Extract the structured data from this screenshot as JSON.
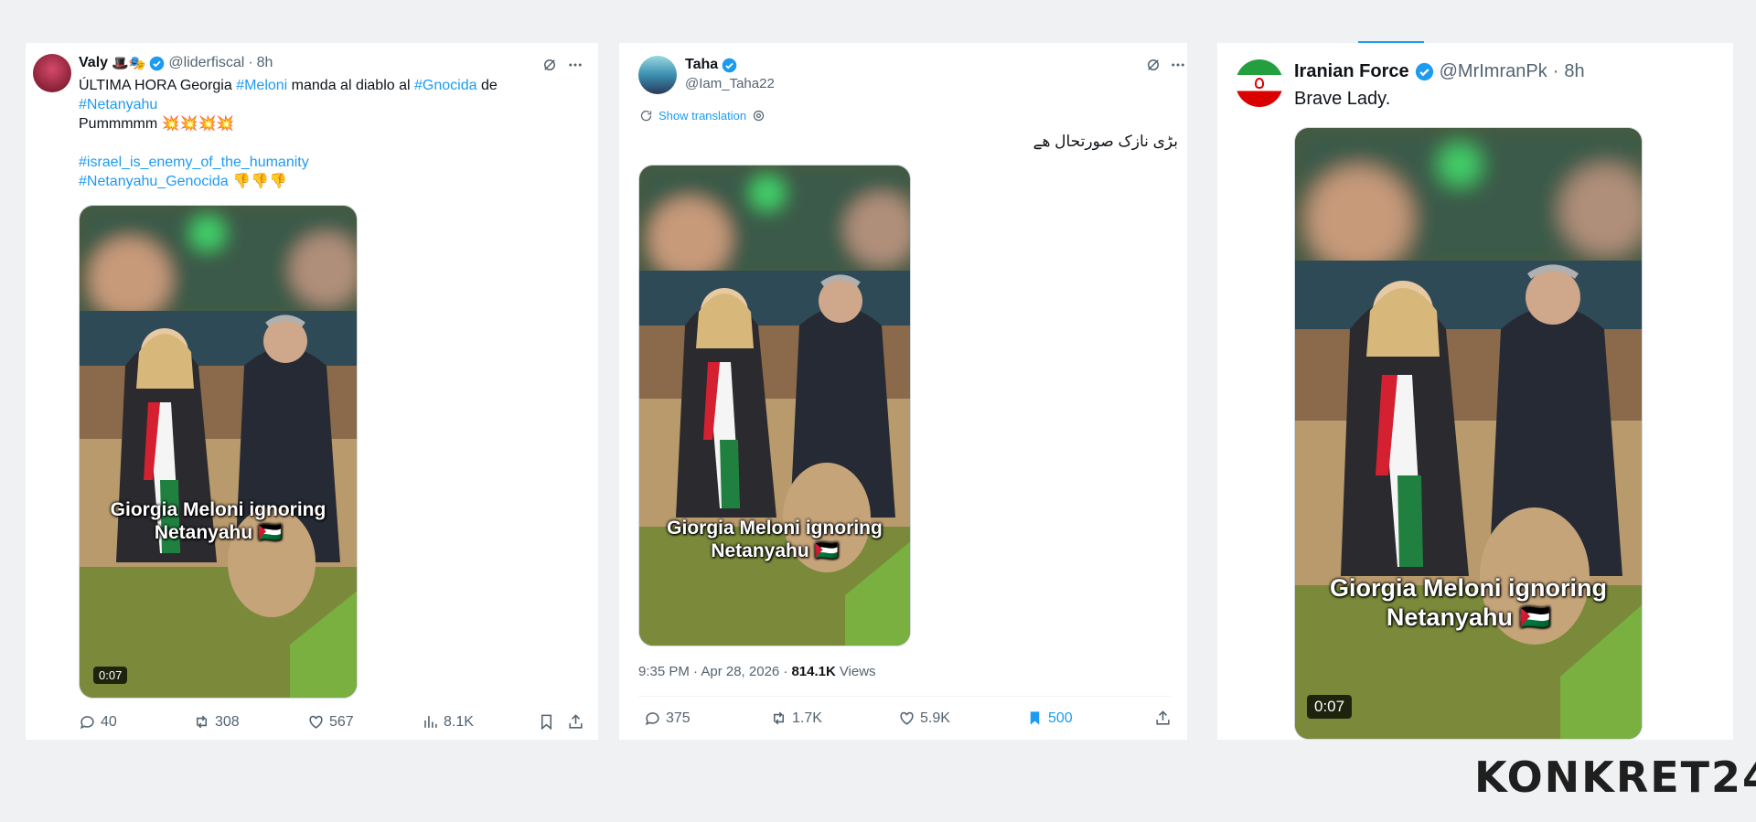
{
  "tweet1": {
    "display_name": "Valy",
    "emojis": "🎩🎭",
    "handle": "@liderfiscal",
    "time": "8h",
    "text_lines": [
      [
        {
          "t": "ÚLTIMA HORA Georgia ",
          "c": "text"
        },
        {
          "t": "#Meloni",
          "c": "link"
        },
        {
          "t": " manda al diablo al ",
          "c": "text"
        },
        {
          "t": "#Gnocida",
          "c": "link"
        },
        {
          "t": " de",
          "c": "text"
        }
      ],
      [
        {
          "t": "#Netanyahu",
          "c": "link"
        }
      ],
      [
        {
          "t": "Pummmmm 💥💥💥💥",
          "c": "text"
        }
      ],
      [
        {
          "t": " ",
          "c": "text"
        }
      ],
      [
        {
          "t": "#israel_is_enemy_of_the_humanity",
          "c": "link"
        }
      ],
      [
        {
          "t": "#Netanyahu_Genocida",
          "c": "link"
        },
        {
          "t": " 👎👎👎",
          "c": "text"
        }
      ]
    ],
    "video_caption_line1": "Giorgia Meloni ignoring",
    "video_caption_line2": "Netanyahu 🇵🇸",
    "duration": "0:07",
    "replies": "40",
    "reposts": "308",
    "likes": "567",
    "views": "8.1K"
  },
  "tweet2": {
    "display_name": "Taha",
    "handle": "@Iam_Taha22",
    "show_translation": "Show translation",
    "text": "بڑی نازک صورتحال ھے",
    "video_caption_line1": "Giorgia Meloni ignoring",
    "video_caption_line2": "Netanyahu 🇵🇸",
    "timestamp": "9:35 PM · Apr 28, 2026 ·",
    "views_count": "814.1K",
    "views_label": "Views",
    "replies": "375",
    "reposts": "1.7K",
    "likes": "5.9K",
    "bookmarks": "500"
  },
  "tweet3": {
    "display_name": "Iranian Force",
    "handle": "@MrImranPk",
    "time": "8h",
    "text": "Brave Lady.",
    "video_caption_line1": "Giorgia Meloni ignoring",
    "video_caption_line2": "Netanyahu 🇵🇸",
    "duration": "0:07"
  },
  "brand": "KONKRET24",
  "colors": {
    "link": "#1d9bf0",
    "muted": "#536471",
    "background": "#f0f1f2"
  }
}
